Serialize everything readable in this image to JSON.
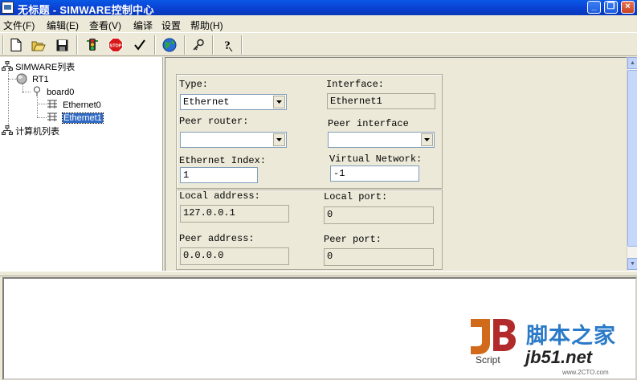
{
  "window": {
    "title": "无标题 - SIMWARE控制中心",
    "controls": [
      "minimize-icon",
      "maximize-icon",
      "close-icon"
    ]
  },
  "menu": [
    "文件(F)",
    "编辑(E)",
    "查看(V)",
    "编译",
    "设置",
    "帮助(H)"
  ],
  "toolbar": {
    "buttons": [
      "new-icon",
      "open-icon",
      "save-icon",
      "traffic-light-icon",
      "stop-icon",
      "check-icon",
      "globe-icon",
      "key-icon",
      "help-icon"
    ]
  },
  "tree": {
    "root1": "SIMWARE列表",
    "router": "RT1",
    "board": "board0",
    "eth0": "Ethernet0",
    "eth1": "Ethernet1",
    "root2": "计算机列表"
  },
  "props": {
    "type_label": "Type:",
    "type_value": "Ethernet",
    "interface_label": "Interface:",
    "interface_value": "Ethernet1",
    "peer_router_label": "Peer router:",
    "peer_router_value": "",
    "peer_interface_label": "Peer interface",
    "peer_interface_value": "",
    "eth_index_label": "Ethernet Index:",
    "eth_index_value": "1",
    "vnet_label": "Virtual Network:",
    "vnet_value": "-1",
    "local_addr_label": "Local address:",
    "local_addr_value": "127.0.0.1",
    "local_port_label": "Local port:",
    "local_port_value": "0",
    "peer_addr_label": "Peer address:",
    "peer_addr_value": "0.0.0.0",
    "peer_port_label": "Peer port:",
    "peer_port_value": "0"
  },
  "watermark": {
    "logo_text": "Script",
    "cn_text": "脚本之家",
    "url_text": "jb51.net",
    "small_text": "www.2CTO.com"
  },
  "colors": {
    "titlebar": "#0a46d8",
    "selection": "#316ac5",
    "face": "#ece9d8"
  }
}
